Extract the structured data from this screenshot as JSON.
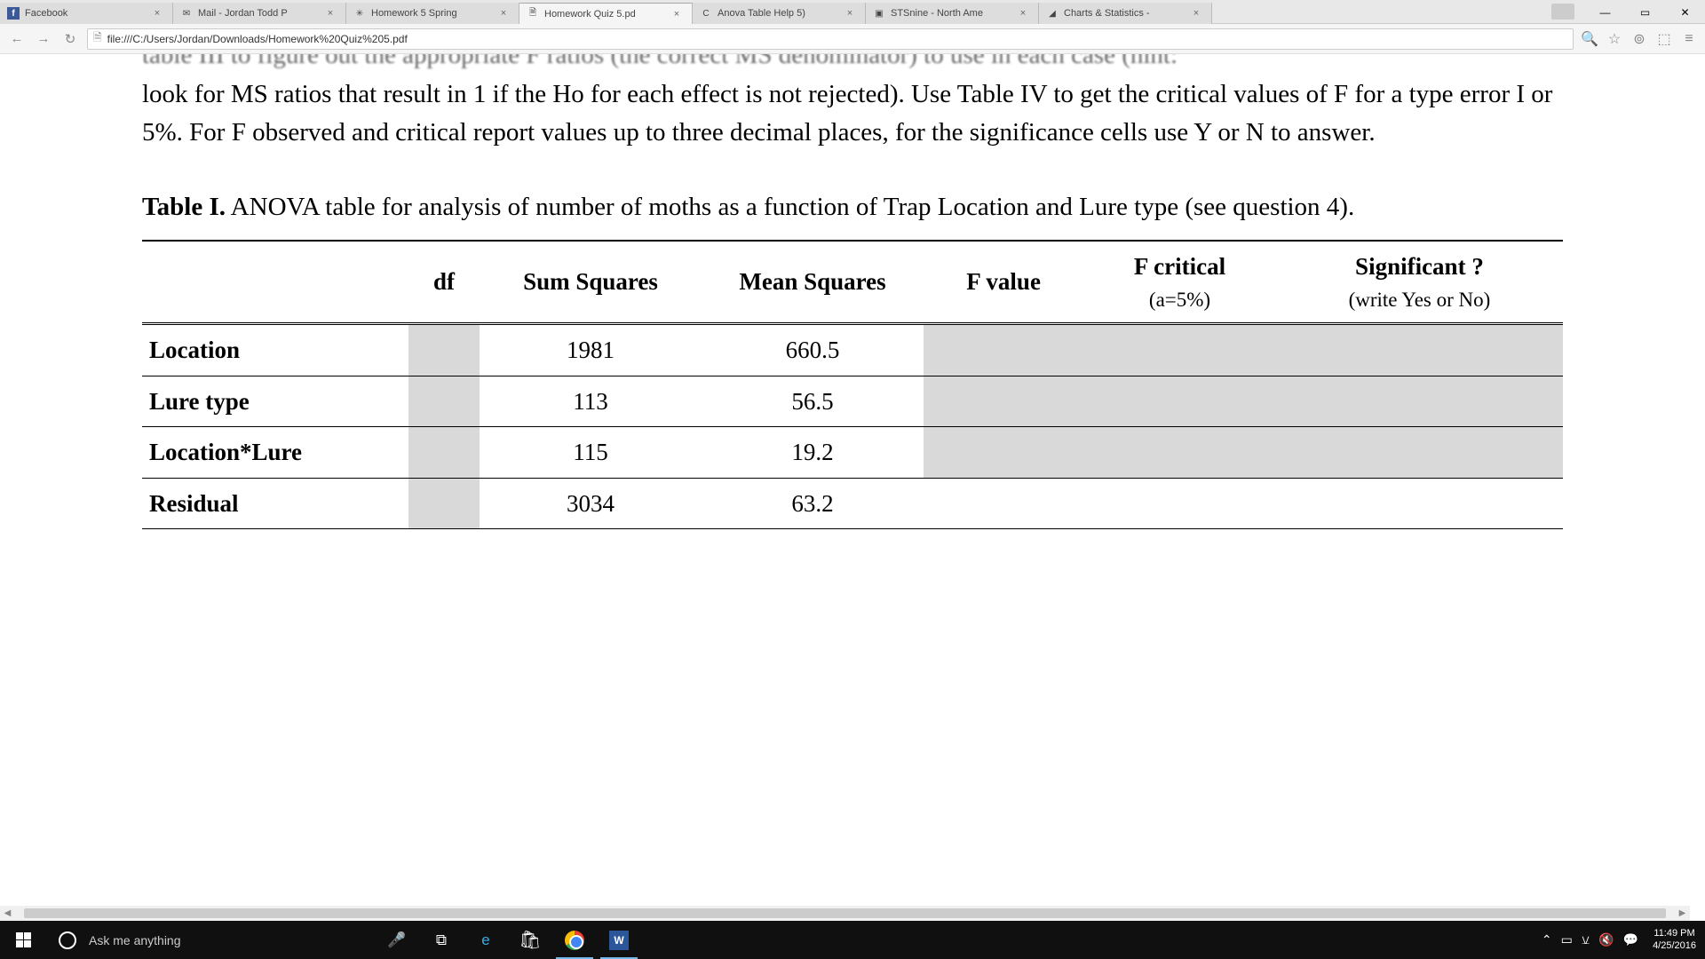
{
  "window_controls": {
    "minimize": "—",
    "maximize": "▭",
    "close": "✕"
  },
  "tabs": [
    {
      "title": "Facebook",
      "favicon": "f"
    },
    {
      "title": "Mail - Jordan Todd P",
      "favicon": "✉"
    },
    {
      "title": "Homework 5 Spring",
      "favicon": "✳"
    },
    {
      "title": "Homework Quiz 5.pd",
      "favicon": "🗎",
      "active": true
    },
    {
      "title": "Anova Table Help 5)",
      "favicon": "C"
    },
    {
      "title": "STSnine - North Ame",
      "favicon": "▣"
    },
    {
      "title": "Charts & Statistics -",
      "favicon": "◢"
    }
  ],
  "tab_close": "×",
  "addr": {
    "back": "←",
    "forward": "→",
    "reload": "↻",
    "url": "file:///C:/Users/Jordan/Downloads/Homework%20Quiz%205.pdf",
    "zoom": "🔍",
    "star": "☆",
    "menu": "≡"
  },
  "doc": {
    "truncated": "table III to figure out the appropriate F ratios (the correct MS denominator) to use in each case (hint:",
    "para": "look for MS ratios that result in 1 if the Ho for each effect is not rejected). Use Table IV to get the critical values of F for a type error I or 5%. For F observed and critical report values up to three decimal places, for the significance cells use Y or N to answer.",
    "caption_bold": "Table I.",
    "caption_rest": " ANOVA table for analysis of number of moths as a function of Trap Location and Lure type (see question 4).",
    "headers": {
      "source": "",
      "df": "df",
      "ss": "Sum Squares",
      "ms": "Mean Squares",
      "f": "F value",
      "fcrit": "F critical",
      "fcrit_sub": "(a=5%)",
      "sig": "Significant ?",
      "sig_sub": "(write Yes or No)"
    },
    "rows": [
      {
        "source": "Location",
        "ss": "1981",
        "ms": "660.5",
        "shade_right": true
      },
      {
        "source": "Lure type",
        "ss": "113",
        "ms": "56.5",
        "shade_right": true
      },
      {
        "source": "Location*Lure",
        "ss": "115",
        "ms": "19.2",
        "shade_right": true
      },
      {
        "source": "Residual",
        "ss": "3034",
        "ms": "63.2",
        "shade_right": false
      }
    ]
  },
  "taskbar": {
    "search_placeholder": "Ask me anything",
    "time": "11:49 PM",
    "date": "4/25/2016",
    "tray": {
      "caret": "⌃",
      "battery": "▭",
      "wifi": "⚺",
      "vol": "🔇",
      "notif": "💬"
    }
  }
}
